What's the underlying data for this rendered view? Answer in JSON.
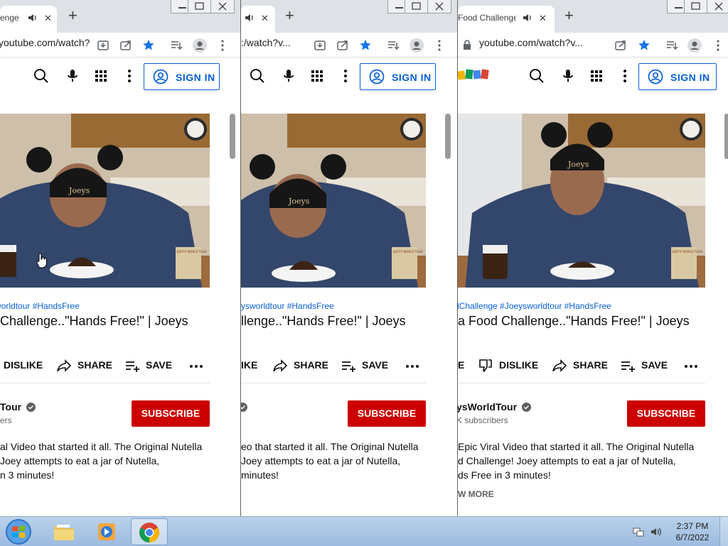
{
  "windows": [
    {
      "tab_title": "enge",
      "url": "youtube.com/watch?v...",
      "hashtags": "e #Joeysworldtour #HandsFree",
      "title": "Challenge..\"Hands Free!\" | Joeys",
      "dislike_label": "DISLIKE",
      "share_label": "SHARE",
      "save_label": "SAVE",
      "channel": "Tour",
      "subs": "ers",
      "subscribe_label": "SUBSCRIBE",
      "sign_in_label": "SIGN IN",
      "desc": [
        "al Video that started it all. The Original Nutella",
        "Joey attempts to eat a jar of Nutella,",
        "n 3 minutes!"
      ]
    },
    {
      "url": ":/watch?v...",
      "hashtags": "ysworldtour #HandsFree",
      "title": "llenge..\"Hands Free!\" | Joeys",
      "dislike_label": "IKE",
      "share_label": "SHARE",
      "save_label": "SAVE",
      "subscribe_label": "SUBSCRIBE",
      "sign_in_label": "SIGN IN",
      "desc": [
        "eo that started it all. The Original Nutella",
        "Joey attempts to eat a jar of Nutella,",
        "minutes!"
      ]
    },
    {
      "tab_title": "Food Challenge..",
      "url": "youtube.com/watch?v...",
      "hashtags": "dChallenge #Joeysworldtour #HandsFree",
      "title": "a Food Challenge..\"Hands Free!\" | Joeys",
      "like_label": "E",
      "dislike_label": "DISLIKE",
      "share_label": "SHARE",
      "save_label": "SAVE",
      "channel": "ysWorldTour",
      "subs": "K subscribers",
      "subscribe_label": "SUBSCRIBE",
      "sign_in_label": "SIGN IN",
      "desc": [
        "Epic Viral Video that started it all. The Original Nutella",
        "d Challenge!  Joey attempts to eat a jar of Nutella,",
        "ds Free in 3 minutes!"
      ],
      "show_more": "W MORE"
    }
  ],
  "video_overlay": {
    "hat_text": "Joeys",
    "badge_text": "JOEY'S WORLD TOUR"
  },
  "taskbar": {
    "time": "2:37 PM",
    "date": "6/7/2022"
  },
  "colors": {
    "accent_blue": "#065fd4",
    "subscribe_red": "#cc0000",
    "star_blue": "#1a73e8"
  }
}
